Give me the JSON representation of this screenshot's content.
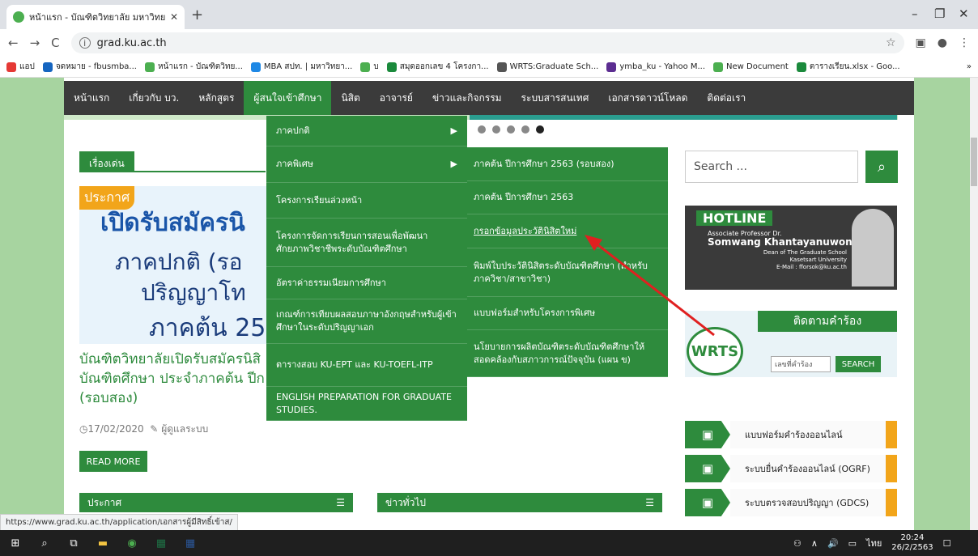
{
  "browser": {
    "tab_title": "หน้าแรก - บัณฑิตวิทยาลัย มหาวิทยาลั",
    "tab_close": "✕",
    "new_tab": "+",
    "win_min": "–",
    "win_max": "❐",
    "win_close": "✕",
    "url": "grad.ku.ac.th",
    "bookmarks": [
      {
        "label": "แอป",
        "color": "#e53935"
      },
      {
        "label": "จดหมาย - fbusmba...",
        "color": "#1565c0"
      },
      {
        "label": "หน้าแรก - บัณฑิตวิทย...",
        "color": "#4caf50"
      },
      {
        "label": "MBA สปท. | มหาวิทยา...",
        "color": "#1e88e5"
      },
      {
        "label": "บ",
        "color": "#4caf50"
      },
      {
        "label": "สมุดออกเลข 4 โครงกา...",
        "color": "#1b8a3c"
      },
      {
        "label": "WRTS:Graduate Sch...",
        "color": "#555555"
      },
      {
        "label": "ymba_ku - Yahoo M...",
        "color": "#5c2d91"
      },
      {
        "label": "New Document",
        "color": "#4caf50"
      },
      {
        "label": "ตารางเรียน.xlsx - Goo...",
        "color": "#1b8a3c"
      }
    ],
    "bookmarks_more": "»",
    "status_url": "https://www.grad.ku.ac.th/application/เอกสารผู้มีสิทธิ์เข้าส/"
  },
  "nav": {
    "items": [
      "หน้าแรก",
      "เกี่ยวกับ บว.",
      "หลักสูตร",
      "ผู้สนใจเข้าศึกษา",
      "นิสิต",
      "อาจารย์",
      "ข่าวและกิจกรรม",
      "ระบบสารสนเทศ",
      "เอกสารดาวน์โหลด",
      "ติดต่อเรา"
    ],
    "active_index": 3
  },
  "dropdown1": [
    "ภาคปกติ",
    "ภาคพิเศษ",
    "โครงการเรียนล่วงหน้า",
    "โครงการจัดการเรียนการสอนเพื่อพัฒนาศักยภาพวิชาชีพระดับบัณฑิตศึกษา",
    "อัตราค่าธรรมเนียมการศึกษา",
    "เกณฑ์การเทียบผลสอบภาษาอังกฤษสำหรับผู้เข้าศึกษาในระดับปริญญาเอก",
    "ตารางสอบ KU-EPT และ KU-TOEFL-ITP",
    "ENGLISH PREPARATION FOR GRADUATE STUDIES."
  ],
  "dropdown2": [
    "ภาคต้น ปีการศึกษา 2563 (รอบสอง)",
    "ภาคต้น ปีการศึกษา 2563",
    "กรอกข้อมูลประวัตินิสิตใหม่",
    "พิมพ์ใบประวัตินิสิตระดับบัณฑิตศึกษา (สำหรับภาควิชา/สาขาวิชา)",
    "แบบฟอร์มสำหรับโครงการพิเศษ",
    "นโยบายการผลิตบัณฑิตระดับบัณฑิตศึกษาให้สอดคล้องกับสภาวการณ์ปัจจุบัน (แผน ข)"
  ],
  "featured": {
    "label": "เรื่องเด่น",
    "banner_tag": "ประกาศ",
    "banner_line1": "เปิดรับสมัครนิ",
    "banner_line2": "ภาคปกติ (รอ",
    "banner_line3": "ปริญญาโท",
    "banner_line4": "ภาคต้น 25",
    "title": "บัณฑิตวิทยาลัยเปิดรับสมัครนิสิ บัณฑิตศึกษา ประจำภาคต้น ปีก (รอบสอง)",
    "date": "17/02/2020",
    "author": "ผู้ดูแลระบบ",
    "read_more": "READ MORE"
  },
  "sections": {
    "announce": "ประกาศ",
    "news": "ข่าวทั่วไป"
  },
  "sidebar": {
    "search_placeholder": "Search ...",
    "hotline_title": "HOTLINE",
    "hotline_sub": "Associate Professor Dr.",
    "hotline_name": "Somwang Khantayanuwong",
    "hotline_pos": "Dean of The Graduate School",
    "hotline_univ": "Kasetsart University",
    "hotline_mail": "E-Mail : fforsok@ku.ac.th",
    "track_title": "ติดตามคำร้อง",
    "wrts_logo": "WRTS",
    "wrts_input": "เลขที่คำร้อง",
    "wrts_btn": "SEARCH",
    "services": [
      "แบบฟอร์มคำร้องออนไลน์",
      "ระบบยื่นคำร้องออนไลน์ (OGRF)",
      "ระบบตรวจสอบปริญญา (GDCS)"
    ]
  },
  "taskbar": {
    "lang": "ไทย",
    "time": "20:24",
    "date": "26/2/2563"
  }
}
